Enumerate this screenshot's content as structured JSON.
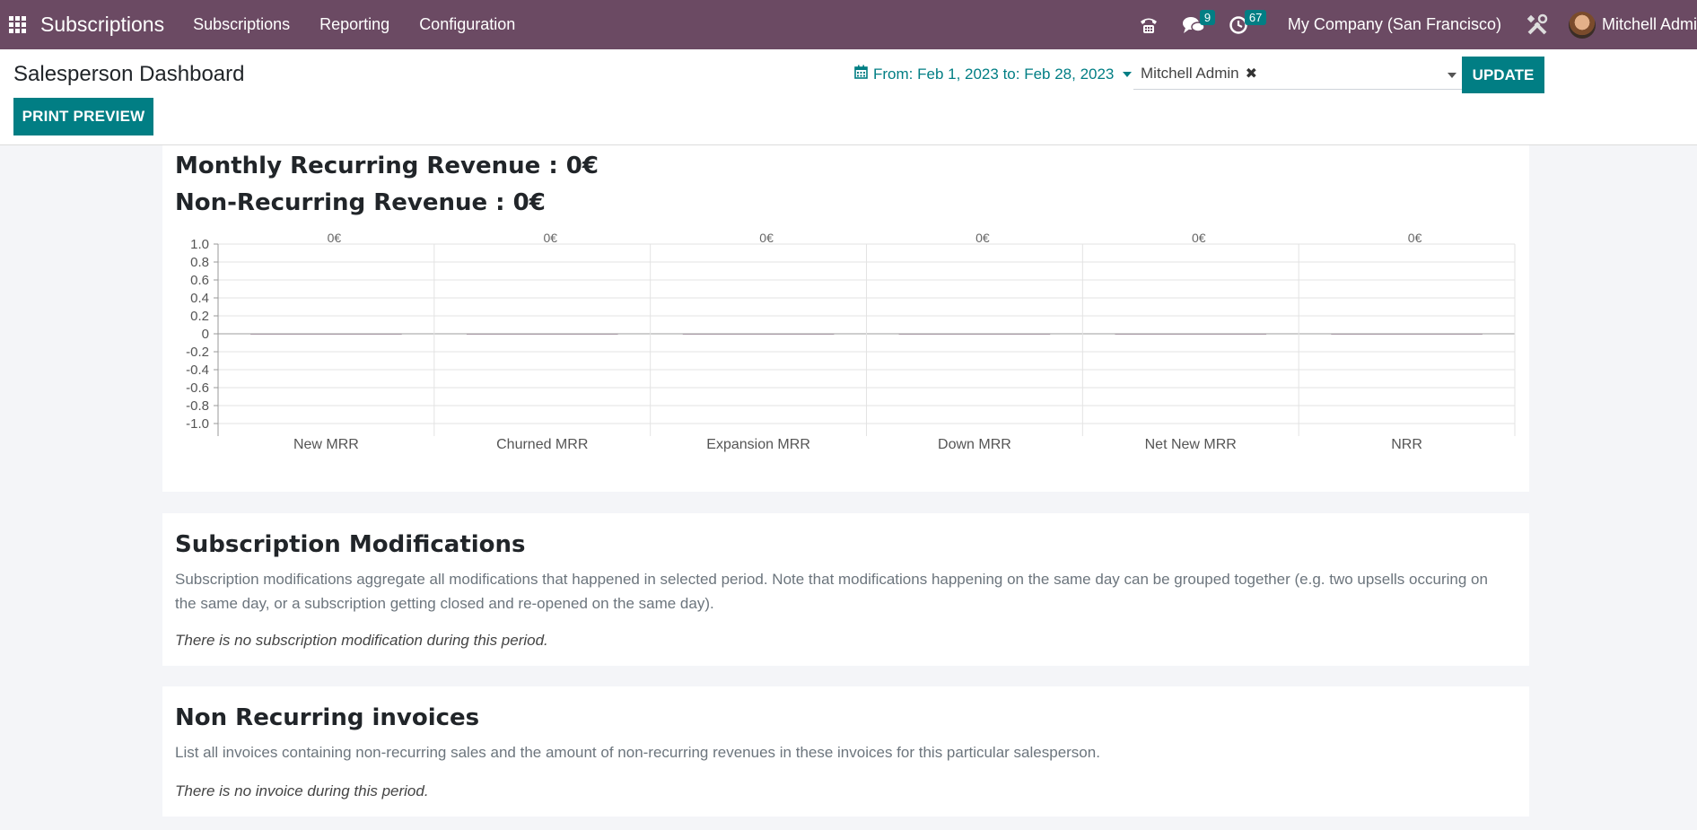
{
  "topbar": {
    "app_title": "Subscriptions",
    "nav": [
      "Subscriptions",
      "Reporting",
      "Configuration"
    ],
    "messages_count": "9",
    "activities_count": "67",
    "company": "My Company (San Francisco)",
    "user": "Mitchell Admi"
  },
  "control": {
    "page_title": "Salesperson Dashboard",
    "print_label": "PRINT PREVIEW",
    "date_range": "From: Feb 1, 2023 to: Feb 28, 2023",
    "salesperson": "Mitchell Admin",
    "remove_symbol": "✖",
    "update_label": "UPDATE"
  },
  "revenue": {
    "mrr": "Monthly Recurring Revenue : 0€",
    "nrr": "Non-Recurring Revenue : 0€"
  },
  "chart_data": {
    "type": "bar",
    "categories": [
      "New MRR",
      "Churned MRR",
      "Expansion MRR",
      "Down MRR",
      "Net New MRR",
      "NRR"
    ],
    "values": [
      0,
      0,
      0,
      0,
      0,
      0
    ],
    "data_labels": [
      "0€",
      "0€",
      "0€",
      "0€",
      "0€",
      "0€"
    ],
    "yticks": [
      "1.0",
      "0.8",
      "0.6",
      "0.4",
      "0.2",
      "0",
      "-0.2",
      "-0.4",
      "-0.6",
      "-0.8",
      "-1.0"
    ],
    "ylim": [
      -1.0,
      1.0
    ],
    "grid": true
  },
  "modifications": {
    "title": "Subscription Modifications",
    "description": "Subscription modifications aggregate all modifications that happened in selected period. Note that modifications happening on the same day can be grouped together (e.g. two upsells occuring on the same day, or a subscription getting closed and re-opened on the same day).",
    "empty": "There is no subscription modification during this period."
  },
  "invoices": {
    "title": "Non Recurring invoices",
    "description": "List all invoices containing non-recurring sales and the amount of non-recurring revenues in these invoices for this particular salesperson.",
    "empty": "There is no invoice during this period."
  },
  "colors": {
    "topbar": "#6b4a63",
    "accent": "#017e84",
    "background": "#f4f5f8"
  }
}
